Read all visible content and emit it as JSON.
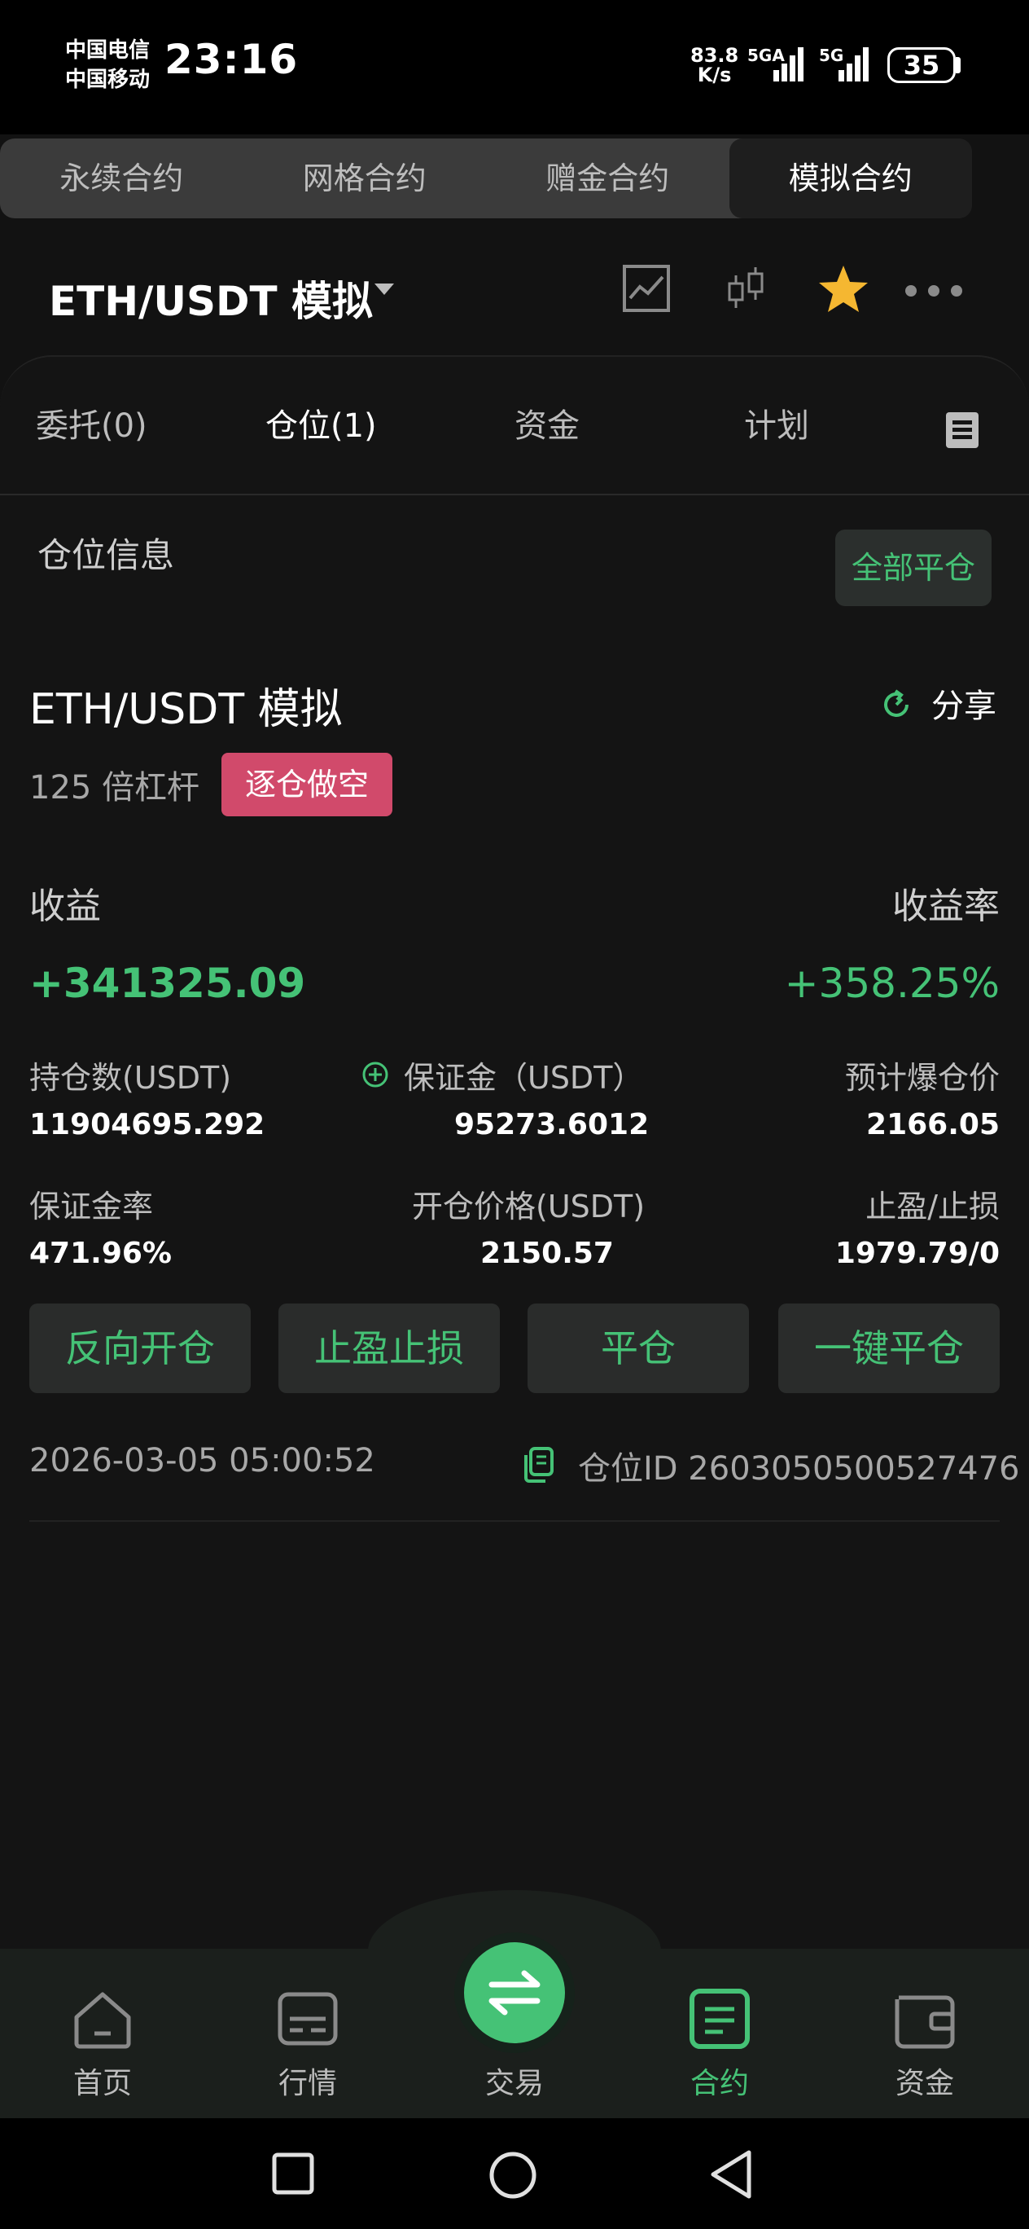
{
  "status_bar": {
    "carrier_1": "中国电信",
    "carrier_2": "中国移动",
    "time": "23:16",
    "net_speed_value": "83.8",
    "net_speed_unit": "K/s",
    "signal_1_tag": "5GA",
    "signal_2_tag": "5G",
    "battery": "35"
  },
  "contract_tabs": [
    "永续合约",
    "网格合约",
    "赠金合约",
    "模拟合约"
  ],
  "header": {
    "pair": "ETH/USDT  模拟",
    "icons": [
      "chart-icon",
      "candlestick-icon",
      "star-icon",
      "more-icon"
    ],
    "star_color": "#f5b731"
  },
  "sub_tabs": {
    "orders": "委托(0)",
    "positions": "仓位(1)",
    "funds": "资金",
    "plans": "计划"
  },
  "position_info": {
    "title": "仓位信息",
    "close_all": "全部平仓",
    "symbol": "ETH/USDT 模拟",
    "share": "分享",
    "leverage": "125 倍杠杆",
    "side": "逐仓做空",
    "pnl_label": "收益",
    "pnl_rate_label": "收益率",
    "pnl": "+341325.09",
    "pnl_rate": "+358.25%",
    "stats": {
      "size_label": "持仓数(USDT)",
      "size": "11904695.292",
      "margin_label": "保证金（USDT）",
      "margin": "95273.6012",
      "liq_label": "预计爆仓价",
      "liq": "2166.05",
      "margin_rate_label": "保证金率",
      "margin_rate": "471.96%",
      "entry_label": "开仓价格(USDT)",
      "entry": "2150.57",
      "tpsl_label": "止盈/止损",
      "tpsl": "1979.79/0"
    },
    "actions": {
      "reverse": "反向开仓",
      "tpsl": "止盈止损",
      "close": "平仓",
      "one_click_close": "一键平仓"
    },
    "time": "2026-03-05 05:00:52",
    "position_id": "仓位ID 2603050500527476"
  },
  "bottom_nav": {
    "home": "首页",
    "market": "行情",
    "trade": "交易",
    "contract": "合约",
    "assets": "资金"
  },
  "colors": {
    "accent": "#45c276",
    "short_badge": "#d14a6b",
    "background": "#121212"
  }
}
